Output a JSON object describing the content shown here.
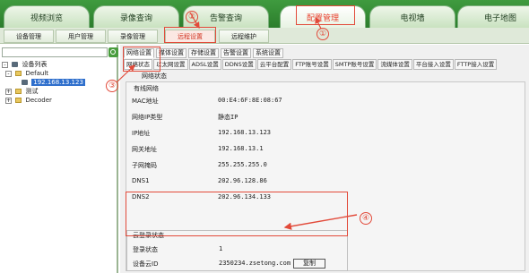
{
  "top_tabs": [
    "视频浏览",
    "录像查询",
    "告警查询",
    "配置管理",
    "电视墙",
    "电子地图"
  ],
  "sub_tabs": [
    "设备管理",
    "用户管理",
    "录像管理",
    "远程设置",
    "远程维护"
  ],
  "left": {
    "search_placeholder": "",
    "tree": {
      "root": "设备列表",
      "default": "Default",
      "selected_device": "192.168.13.123",
      "test": "测试",
      "decoder": "Decoder"
    }
  },
  "settings_tabs": [
    "网络设置",
    "媒体设置",
    "存储设置",
    "告警设置",
    "系统设置"
  ],
  "net_tabs": [
    "网络状态",
    "以太网设置",
    "ADSL设置",
    "DDNS设置",
    "云平台配置",
    "FTP账号设置",
    "SMTP账号设置",
    "流媒体设置",
    "平台接入设置",
    "FTTP接入设置"
  ],
  "subnav": "网络状态",
  "wired": {
    "title": "有线网络",
    "rows": [
      {
        "label": "MAC地址",
        "value": "00:E4:6F:8E:08:67"
      },
      {
        "label": "网络IP类型",
        "value": "静态IP"
      },
      {
        "label": "IP地址",
        "value": "192.168.13.123"
      },
      {
        "label": "网关地址",
        "value": "192.168.13.1"
      },
      {
        "label": "子网掩码",
        "value": "255.255.255.0"
      },
      {
        "label": "DNS1",
        "value": "202.96.128.86"
      },
      {
        "label": "DNS2",
        "value": "202.96.134.133"
      }
    ]
  },
  "cloud": {
    "title": "云登录状态",
    "status_label": "登录状态",
    "status_value": "1",
    "id_label": "设备云ID",
    "id_value": "2350234.zsetong.com",
    "copy_label": "复制"
  },
  "annotations": [
    "①",
    "②",
    "③",
    "④"
  ],
  "colors": {
    "accent_green": "#2c7d2c",
    "annotation_red": "#e24a3a"
  }
}
